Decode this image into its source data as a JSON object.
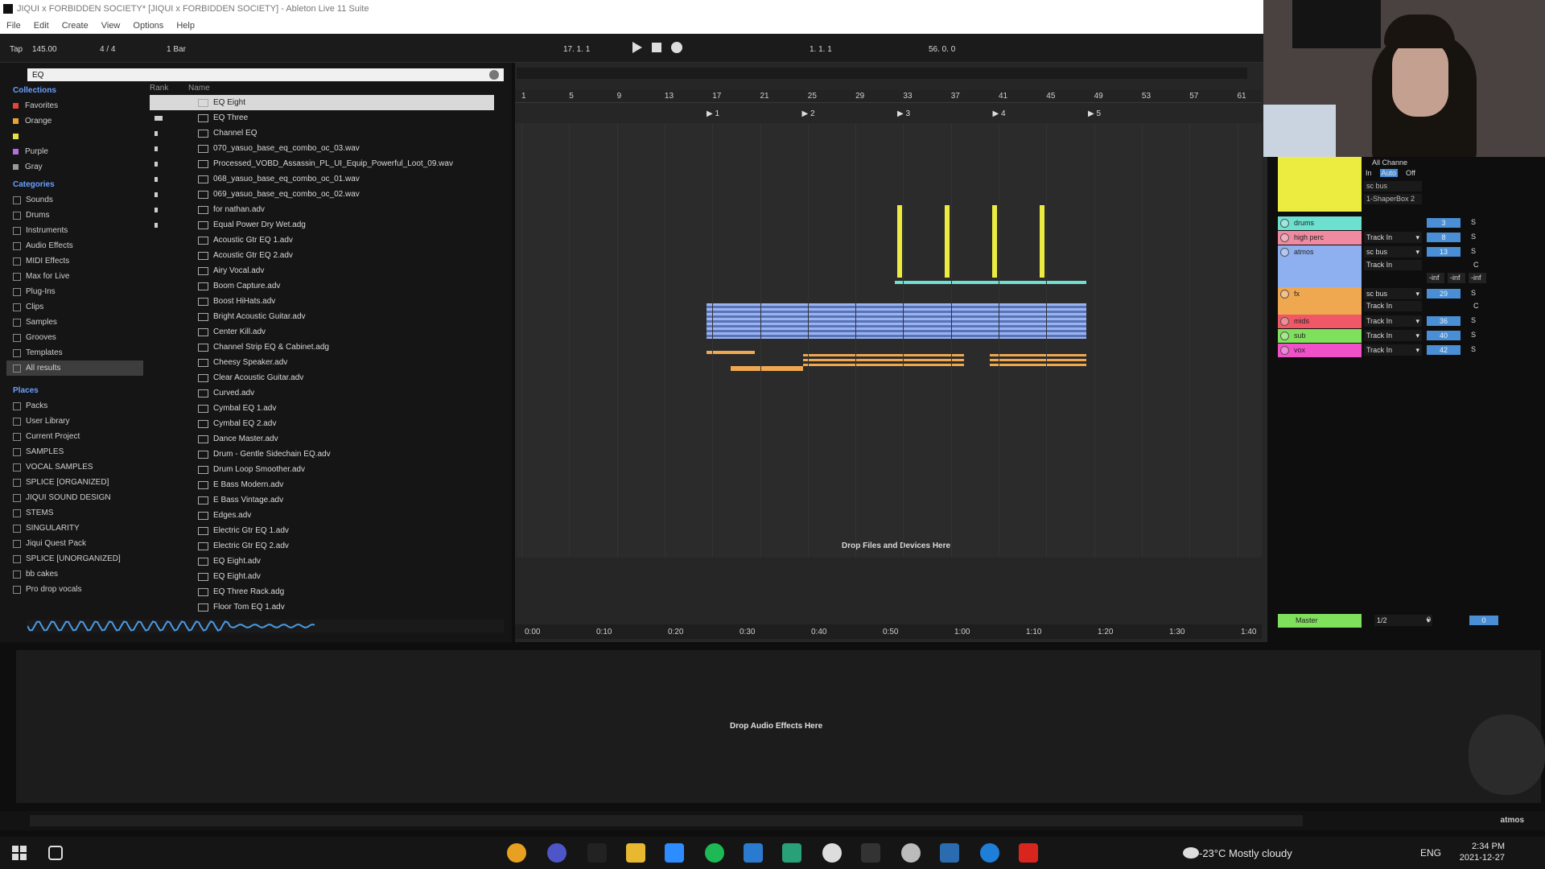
{
  "window": {
    "title": "JIQUI x FORBIDDEN SOCIETY* [JIQUI x FORBIDDEN SOCIETY] - Ableton Live 11 Suite"
  },
  "menu": [
    "File",
    "Edit",
    "Create",
    "View",
    "Options",
    "Help"
  ],
  "transport": {
    "tap": "Tap",
    "tempo": "145.00",
    "meter": "4 / 4",
    "quantize": "1 Bar",
    "position": "17.   1.   1",
    "loop_start": "1.   1.   1",
    "loop_length": "56.   0.   0"
  },
  "browser": {
    "search": "EQ",
    "collections_header": "Collections",
    "collections": [
      {
        "label": "Favorites",
        "color": "#e8443a"
      },
      {
        "label": "Orange",
        "color": "#f0a030"
      },
      {
        "label": "",
        "color": "#e8e040"
      },
      {
        "label": "Purple",
        "color": "#b070e0"
      },
      {
        "label": "Gray",
        "color": "#9a9a9a"
      }
    ],
    "categories_header": "Categories",
    "categories": [
      "Sounds",
      "Drums",
      "Instruments",
      "Audio Effects",
      "MIDI Effects",
      "Max for Live",
      "Plug-Ins",
      "Clips",
      "Samples",
      "Grooves",
      "Templates",
      "All results"
    ],
    "places_header": "Places",
    "places": [
      "Packs",
      "User Library",
      "Current Project",
      "SAMPLES",
      "VOCAL SAMPLES",
      "SPLICE [ORGANIZED]",
      "JIQUI SOUND DESIGN",
      "STEMS",
      "SINGULARITY",
      "Jiqui Quest Pack",
      "SPLICE [UNORGANIZED]",
      "bb cakes",
      "Pro drop vocals"
    ],
    "col_rank": "Rank",
    "col_name": "Name",
    "files": [
      "EQ Eight",
      "EQ Three",
      "Channel EQ",
      "070_yasuo_base_eq_combo_oc_03.wav",
      "Processed_VOBD_Assassin_PL_UI_Equip_Powerful_Loot_09.wav",
      "068_yasuo_base_eq_combo_oc_01.wav",
      "069_yasuo_base_eq_combo_oc_02.wav",
      "for nathan.adv",
      "Equal Power Dry Wet.adg",
      "Acoustic Gtr EQ 1.adv",
      "Acoustic Gtr EQ 2.adv",
      "Airy Vocal.adv",
      "Boom Capture.adv",
      "Boost HiHats.adv",
      "Bright Acoustic Guitar.adv",
      "Center Kill.adv",
      "Channel Strip EQ & Cabinet.adg",
      "Cheesy Speaker.adv",
      "Clear Acoustic Guitar.adv",
      "Curved.adv",
      "Cymbal EQ 1.adv",
      "Cymbal EQ 2.adv",
      "Dance Master.adv",
      "Drum - Gentle Sidechain EQ.adv",
      "Drum Loop Smoother.adv",
      "E Bass Modern.adv",
      "E Bass Vintage.adv",
      "Edges.adv",
      "Electric Gtr EQ 1.adv",
      "Electric Gtr EQ 2.adv",
      "EQ Eight.adv",
      "EQ Eight.adv",
      "EQ Three Rack.adg",
      "Floor Tom EQ 1.adv"
    ]
  },
  "arrangement": {
    "bars": [
      "1",
      "5",
      "9",
      "13",
      "17",
      "21",
      "25",
      "29",
      "33",
      "37",
      "41",
      "45",
      "49",
      "53",
      "57",
      "61"
    ],
    "scenes": [
      "1",
      "2",
      "3",
      "4",
      "5"
    ],
    "times": [
      "0:00",
      "0:10",
      "0:20",
      "0:30",
      "0:40",
      "0:50",
      "1:00",
      "1:10",
      "1:20",
      "1:30",
      "1:40"
    ],
    "drop_text": "Drop Files and Devices Here"
  },
  "mixer": {
    "routing_header": "All Channe",
    "monitor": [
      "In",
      "Auto",
      "Off"
    ],
    "io_top": "sc bus",
    "io_device": "1-ShaperBox 2",
    "tracks": [
      {
        "name": "drums",
        "color": "#6ee0d0",
        "io": "",
        "vol": "3"
      },
      {
        "name": "high perc",
        "color": "#f08aa0",
        "io": "Track In",
        "vol": "8"
      },
      {
        "name": "atmos",
        "color": "#8fb0f0",
        "io": "sc bus",
        "vol": "13"
      },
      {
        "name": "fx",
        "color": "#f0a850",
        "io": "sc bus",
        "vol": "29"
      },
      {
        "name": "mids",
        "color": "#f05868",
        "io": "Track In",
        "vol": "36"
      },
      {
        "name": "sub",
        "color": "#7fe05c",
        "io": "Track In",
        "vol": "40"
      },
      {
        "name": "vox",
        "color": "#f050c8",
        "io": "Track In",
        "vol": "42"
      }
    ],
    "atmos_io2": "Track In",
    "atmos_pan": "C",
    "fx_io2": "Track In",
    "fx_pan": "C",
    "inf": "-inf",
    "master": {
      "name": "Master",
      "io": "1/2",
      "vol": "0",
      "cue": "0"
    }
  },
  "device": {
    "drop_text": "Drop Audio Effects Here"
  },
  "status": {
    "track": "atmos"
  },
  "taskbar": {
    "weather": "-23°C  Mostly cloudy",
    "lang": "ENG",
    "time": "2:34 PM",
    "date": "2021-12-27"
  }
}
